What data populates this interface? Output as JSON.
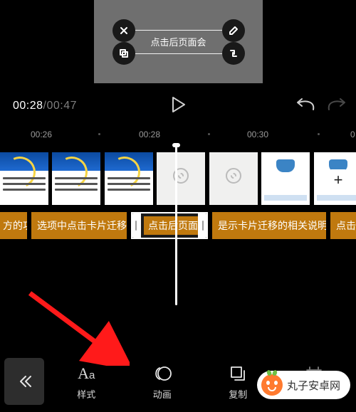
{
  "preview": {
    "overlay_text": "点击后页面会"
  },
  "playbar": {
    "current": "00:28",
    "duration": "00:47"
  },
  "ruler": {
    "t1": "00:26",
    "t2": "00:28",
    "t3": "00:30",
    "t4": "0"
  },
  "text_clips": {
    "c1": "方的功",
    "c2": "选项中点击卡片迁移",
    "c3": "点击后页面",
    "c4": "是示卡片迁移的相关说明",
    "c5": "点击下"
  },
  "add_label": "+",
  "toolbar": {
    "style": "样式",
    "anim": "动画",
    "copy": "复制",
    "crop": "裁剪"
  },
  "watermark": "丸子安卓网"
}
